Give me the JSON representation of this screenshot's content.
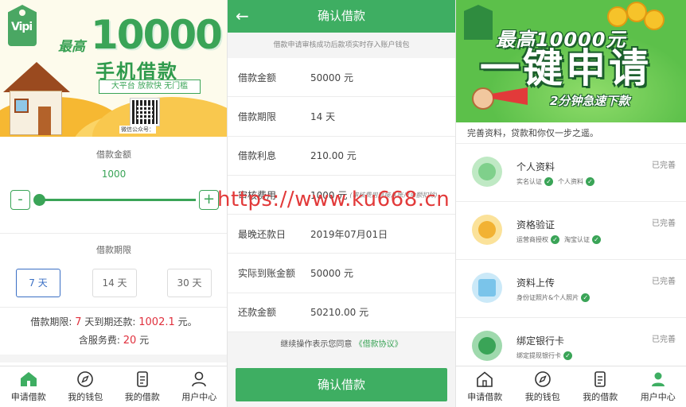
{
  "panel1": {
    "banner": {
      "tag_text": "Vipi",
      "max_prefix": "最高",
      "amount": "10000",
      "title": "手机借款",
      "slogan": "大平台 放款快 无门槛",
      "qr_caption": "微信公众号："
    },
    "loan_amount_label": "借款金额",
    "loan_amount_value": "1000",
    "slider_minus": "-",
    "slider_plus": "+",
    "slider_value_fraction": 0.0,
    "loan_period_label": "借款期限",
    "periods": [
      "7 天",
      "14 天",
      "30 天"
    ],
    "selected_period_index": 0,
    "summary": {
      "prefix": "借款期限:",
      "days": "7",
      "mid": "天到期还款:",
      "repay": "1002.1",
      "unit": "元。",
      "fee_prefix": "含服务费:",
      "fee": "20",
      "fee_unit": "元"
    }
  },
  "tabs": [
    {
      "label": "申请借款",
      "icon": "home-icon"
    },
    {
      "label": "我的钱包",
      "icon": "compass-icon"
    },
    {
      "label": "我的借款",
      "icon": "document-icon"
    },
    {
      "label": "用户中心",
      "icon": "user-icon"
    }
  ],
  "panel2": {
    "back": "←",
    "title": "确认借款",
    "note": "借款申请审核成功后款项实时存入账户钱包",
    "rows": [
      {
        "key": "借款金额",
        "value": "50000 元",
        "extra": ""
      },
      {
        "key": "借款期限",
        "value": "14 天",
        "extra": ""
      },
      {
        "key": "借款利息",
        "value": "210.00 元",
        "extra": ""
      },
      {
        "key": "审核费用",
        "value": "1000 元",
        "extra": "(审核费用直接从账户余额扣除)"
      },
      {
        "key": "最晚还款日",
        "value": "2019年07月01日",
        "extra": ""
      },
      {
        "key": "实际到账金额",
        "value": "50000 元",
        "extra": ""
      },
      {
        "key": "还款金额",
        "value": "50210.00 元",
        "extra": ""
      }
    ],
    "agree_text": "继续操作表示您同意",
    "agree_link": "《借款协议》",
    "confirm_button": "确认借款"
  },
  "watermark": "https://www.ku668.cn",
  "panel3": {
    "banner": {
      "line1": "最高10000元",
      "line2": "一键申请",
      "line3": "2分钟急速下款"
    },
    "tagline": "完善资料，贷款和你仅一步之遥。",
    "items": [
      {
        "name": "个人资料",
        "subs": [
          "实名认证",
          "个人资料"
        ],
        "status": "已完善",
        "icon": "person-profile-icon",
        "color": "#7fd08b",
        "inner": "#bfe9c4"
      },
      {
        "name": "资格验证",
        "subs": [
          "运营商授权",
          "淘宝认证"
        ],
        "status": "已完善",
        "icon": "shield-verify-icon",
        "color": "#f2b233",
        "inner": "#fbe29a"
      },
      {
        "name": "资料上传",
        "subs": [
          "身份证照片&个人照片"
        ],
        "status": "已完善",
        "icon": "upload-document-icon",
        "color": "#7ac4ea",
        "inner": "#cbe9f8"
      },
      {
        "name": "绑定银行卡",
        "subs": [
          "绑定提现银行卡"
        ],
        "status": "已完善",
        "icon": "bank-card-icon",
        "color": "#3aa457",
        "inner": "#9fd9ad"
      }
    ]
  },
  "colors": {
    "accent": "#3eae62",
    "red": "#e0303d",
    "selected_period": "#3a6fc4",
    "watermark": "#e23a3a"
  }
}
